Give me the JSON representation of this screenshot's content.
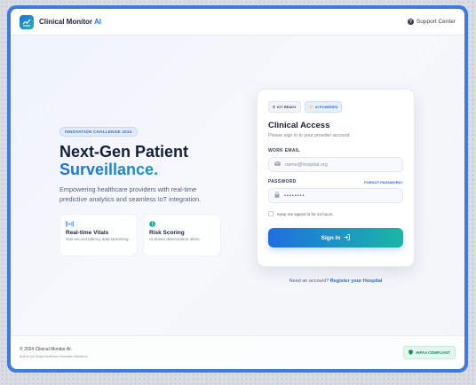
{
  "header": {
    "brand_name": "Clinical Monitor",
    "brand_suffix": "AI",
    "support_label": "Support Center"
  },
  "hero": {
    "badge": "INNOVATION CHALLENGE 2024",
    "title_line1": "Next-Gen Patient",
    "title_line2": "Surveillance.",
    "description": "Empowering healthcare providers with real-time predictive analytics and seamless IoT integration.",
    "features": [
      {
        "icon": "signal-icon",
        "title": "Real-time Vitals",
        "desc": "Sub-second latency data streaming."
      },
      {
        "icon": "info-icon",
        "title": "Risk Scoring",
        "desc": "AI-driven deterioration alerts."
      }
    ]
  },
  "login": {
    "badges": [
      {
        "icon": "iot-icon",
        "label": "IOT READY"
      },
      {
        "icon": "bolt-icon",
        "label": "AI POWERED"
      }
    ],
    "title": "Clinical Access",
    "subtitle": "Please sign in to your provider account.",
    "email_label": "WORK EMAIL",
    "email_placeholder": "name@hospital.org",
    "password_label": "PASSWORD",
    "forgot_label": "FORGOT PASSWORD?",
    "password_value": "••••••••",
    "remember_label": "Keep me signed in for 24 hours",
    "remember_checked": false,
    "signin_label": "Sign In",
    "register_prefix": "Need an account?",
    "register_link": "Register your Hospital"
  },
  "footer": {
    "copyright": "© 2024 Clinical Monitor AI.",
    "built_for": "Built for the Global Healthcare Innovation Hackathon",
    "hipaa_label": "HIPAA COMPLIANT"
  },
  "colors": {
    "frame": "#3d7be0",
    "accent_blue": "#1e6fe0",
    "accent_teal": "#1cb6a6",
    "hipaa_green": "#1a8e5c"
  }
}
